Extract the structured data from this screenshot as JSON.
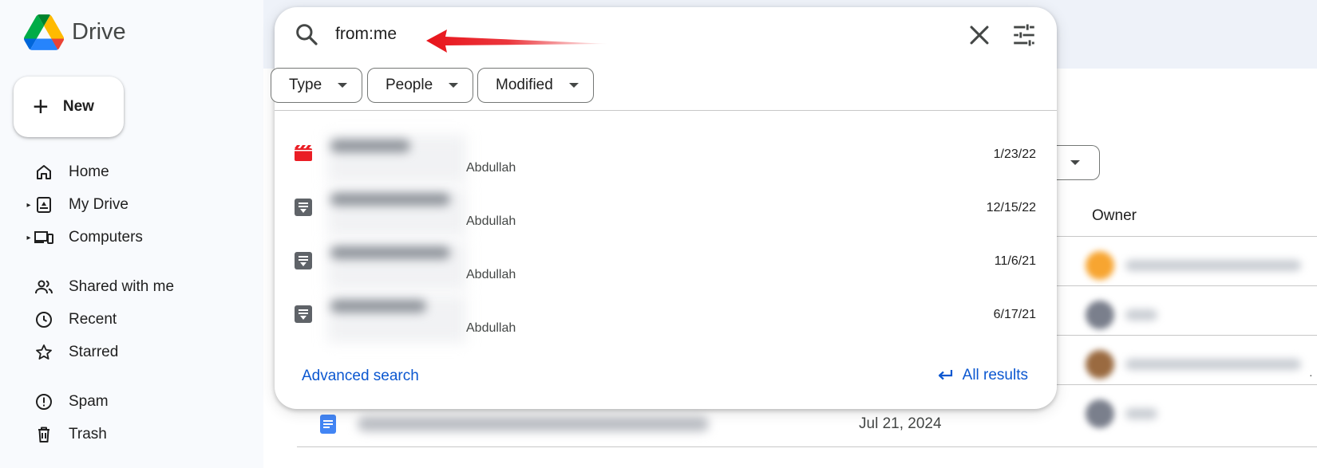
{
  "app": {
    "brand": "Drive"
  },
  "sidebar": {
    "new_label": "New",
    "items": [
      {
        "label": "Home",
        "icon": "home-icon",
        "expandable": false
      },
      {
        "label": "My Drive",
        "icon": "my-drive-icon",
        "expandable": true
      },
      {
        "label": "Computers",
        "icon": "computers-icon",
        "expandable": true
      },
      {
        "label": "Shared with me",
        "icon": "people-icon",
        "expandable": false
      },
      {
        "label": "Recent",
        "icon": "clock-icon",
        "expandable": false
      },
      {
        "label": "Starred",
        "icon": "star-icon",
        "expandable": false
      },
      {
        "label": "Spam",
        "icon": "spam-icon",
        "expandable": false
      },
      {
        "label": "Trash",
        "icon": "trash-icon",
        "expandable": false
      }
    ]
  },
  "search": {
    "value": "from:me",
    "chips": [
      "Type",
      "People",
      "Modified"
    ],
    "results": [
      {
        "icon": "video-file-icon",
        "owner": "Abdullah",
        "date": "1/23/22"
      },
      {
        "icon": "audio-file-icon",
        "owner": "Abdullah",
        "date": "12/15/22"
      },
      {
        "icon": "audio-file-icon",
        "owner": "Abdullah",
        "date": "11/6/21"
      },
      {
        "icon": "audio-file-icon",
        "owner": "Abdullah",
        "date": "6/17/21"
      }
    ],
    "advanced_label": "Advanced search",
    "all_results_label": "All results"
  },
  "main": {
    "owner_header": "Owner",
    "visible_row_date": "Jul 21, 2024"
  },
  "colors": {
    "accent": "#0b57d0",
    "annotation_arrow": "#e8141b",
    "video_icon": "#ea1d25",
    "audio_icon": "#5f6368",
    "doc_icon": "#4285f4"
  }
}
